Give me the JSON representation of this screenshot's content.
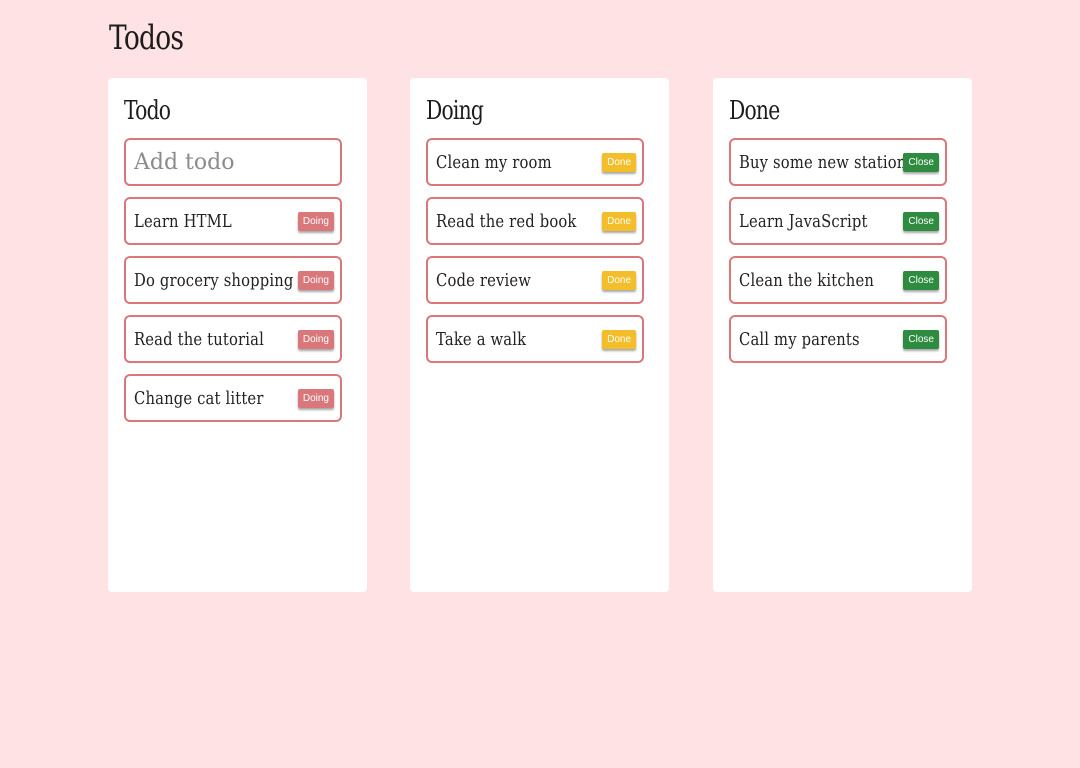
{
  "page": {
    "title": "Todos"
  },
  "columns": {
    "todo": {
      "title": "Todo",
      "input_placeholder": "Add todo",
      "button_label": "Doing",
      "items": [
        "Learn HTML",
        "Do grocery shopping",
        "Read the tutorial",
        "Change cat litter"
      ]
    },
    "doing": {
      "title": "Doing",
      "button_label": "Done",
      "items": [
        "Clean my room",
        "Read the red book",
        "Code review",
        "Take a walk"
      ]
    },
    "done": {
      "title": "Done",
      "button_label": "Close",
      "items": [
        "Buy some new stationary",
        "Learn JavaScript",
        "Clean the kitchen",
        "Call my parents"
      ]
    }
  },
  "colors": {
    "background": "#ffe2e4",
    "card_border": "#d9777a",
    "doing_button": "#d9777a",
    "done_button": "#f4bd2a",
    "close_button": "#2e8b3f"
  }
}
